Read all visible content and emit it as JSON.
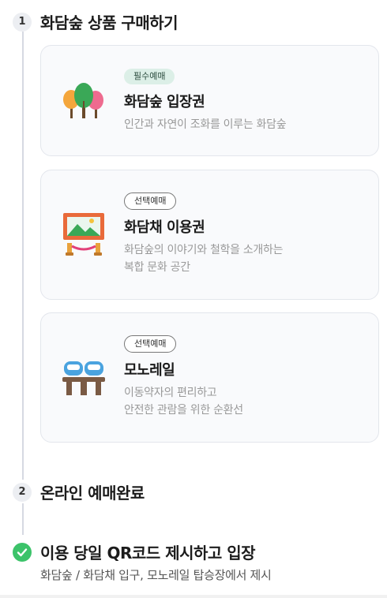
{
  "steps": [
    {
      "number": "1",
      "title": "화담숲 상품 구매하기"
    },
    {
      "number": "2",
      "title": "온라인 예매완료"
    },
    {
      "title": "이용 당일 QR코드 제시하고 입장",
      "description": "화담숲 / 화담채 입구, 모노레일 탑승장에서 제시"
    }
  ],
  "products": [
    {
      "badge": "필수예매",
      "title": "화담숲 입장권",
      "desc_lines": [
        "인간과 자연이 조화를 이루는 화담숲"
      ],
      "icon": "forest-trees-icon"
    },
    {
      "badge": "선택예매",
      "title": "화담채 이용권",
      "desc_lines": [
        "화담숲의 이야기와 철학을 소개하는",
        "복합 문화 공간"
      ],
      "icon": "framed-landscape-exhibit-icon"
    },
    {
      "badge": "선택예매",
      "title": "모노레일",
      "desc_lines": [
        "이동약자의 편리하고",
        "안전한 관람을 위한 순환선"
      ],
      "icon": "monorail-icon"
    }
  ],
  "colors": {
    "required_badge_bg": "#dcefe7",
    "check_green": "#3cc36a"
  }
}
